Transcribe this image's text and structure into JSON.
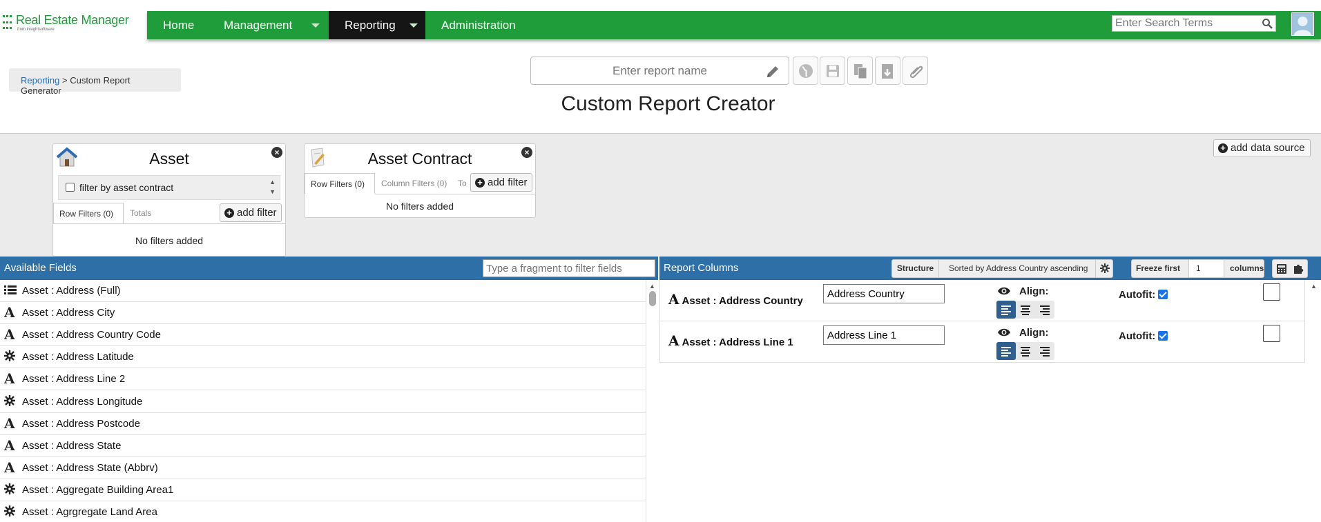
{
  "app": {
    "logo_name": "Real Estate Manager",
    "logo_sub": "from insightsoftware",
    "brand_color": "#1f9d3a"
  },
  "nav": {
    "home": "Home",
    "management": "Management",
    "reporting": "Reporting",
    "administration": "Administration",
    "search_placeholder": "Enter Search Terms"
  },
  "breadcrumb": {
    "link": "Reporting",
    "separator": " > ",
    "current": "Custom Report Generator"
  },
  "report": {
    "name_placeholder": "Enter report name",
    "title": "Custom Report Creator"
  },
  "sources": {
    "add_data_source": "add data source",
    "cards": [
      {
        "title": "Asset",
        "filter_checkbox_label": "filter by asset contract",
        "tabs": [
          "Row Filters (0)",
          "Totals"
        ],
        "add_filter": "add filter",
        "empty_text": "No filters added"
      },
      {
        "title": "Asset Contract",
        "tabs": [
          "Row Filters (0)",
          "Column Filters (0)",
          "To"
        ],
        "add_filter": "add filter",
        "empty_text": "No filters added"
      }
    ]
  },
  "available_fields": {
    "heading": "Available Fields",
    "filter_placeholder": "Type a fragment to filter fields",
    "items": [
      {
        "icon": "list-icon",
        "label": "Asset : Address (Full)"
      },
      {
        "icon": "text-icon",
        "label": "Asset : Address City"
      },
      {
        "icon": "text-icon",
        "label": "Asset : Address Country Code"
      },
      {
        "icon": "gear-icon",
        "label": "Asset : Address Latitude"
      },
      {
        "icon": "text-icon",
        "label": "Asset : Address Line 2"
      },
      {
        "icon": "gear-icon",
        "label": "Asset : Address Longitude"
      },
      {
        "icon": "text-icon",
        "label": "Asset : Address Postcode"
      },
      {
        "icon": "text-icon",
        "label": "Asset : Address State"
      },
      {
        "icon": "text-icon",
        "label": "Asset : Address State (Abbrv)"
      },
      {
        "icon": "gear-icon",
        "label": "Asset : Aggregate Building Area1"
      },
      {
        "icon": "gear-icon",
        "label": "Asset : Agrgregate Land Area"
      }
    ]
  },
  "report_columns": {
    "heading": "Report Columns",
    "structure_label": "Structure",
    "sort_text": "Sorted by Address Country ascending",
    "freeze_label": "Freeze first",
    "freeze_value": "1",
    "columns_label": "columns",
    "align_label": "Align:",
    "autofit_label": "Autofit:",
    "rows": [
      {
        "field": "Asset : Address Country",
        "header": "Address Country",
        "autofit": true
      },
      {
        "field": "Asset : Address Line 1",
        "header": "Address Line 1",
        "autofit": true
      }
    ]
  }
}
